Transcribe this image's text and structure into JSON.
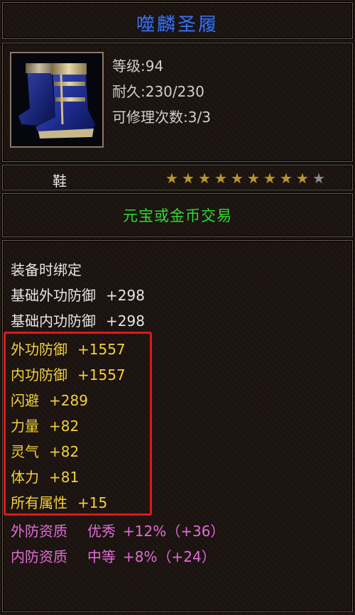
{
  "item": {
    "name": "噬麟圣履",
    "level_label": "等级:94",
    "durability_label": "耐久:230/230",
    "repair_label": "可修理次数:3/3",
    "type": "鞋",
    "stars_filled": 9,
    "stars_total": 10,
    "trade": "元宝或金币交易"
  },
  "attributes": {
    "bind": "装备时绑定",
    "base": [
      {
        "name": "基础外功防御",
        "value": "+298"
      },
      {
        "name": "基础内功防御",
        "value": "+298"
      }
    ],
    "bonus": [
      {
        "name": "外功防御",
        "value": "+1557"
      },
      {
        "name": "内功防御",
        "value": "+1557"
      },
      {
        "name": "闪避",
        "value": "+289"
      },
      {
        "name": "力量",
        "value": "+82"
      },
      {
        "name": "灵气",
        "value": "+82"
      },
      {
        "name": "体力",
        "value": "+81"
      },
      {
        "name": "所有属性",
        "value": "+15"
      }
    ],
    "aptitude": [
      {
        "name": "外防资质",
        "grade": "优秀",
        "value": "+12%（+36）"
      },
      {
        "name": "内防资质",
        "grade": "中等",
        "value": "+8%（+24）"
      }
    ]
  },
  "colors": {
    "title": "#3c73e8",
    "trade": "#2edc2e",
    "bonus": "#f3d23b",
    "aptitude": "#e26cd8",
    "highlight": "#e01818",
    "star_on": "#b8952c",
    "star_off": "#8c8c8c"
  },
  "icons": {
    "item": "boots-icon",
    "star": "star-icon"
  }
}
